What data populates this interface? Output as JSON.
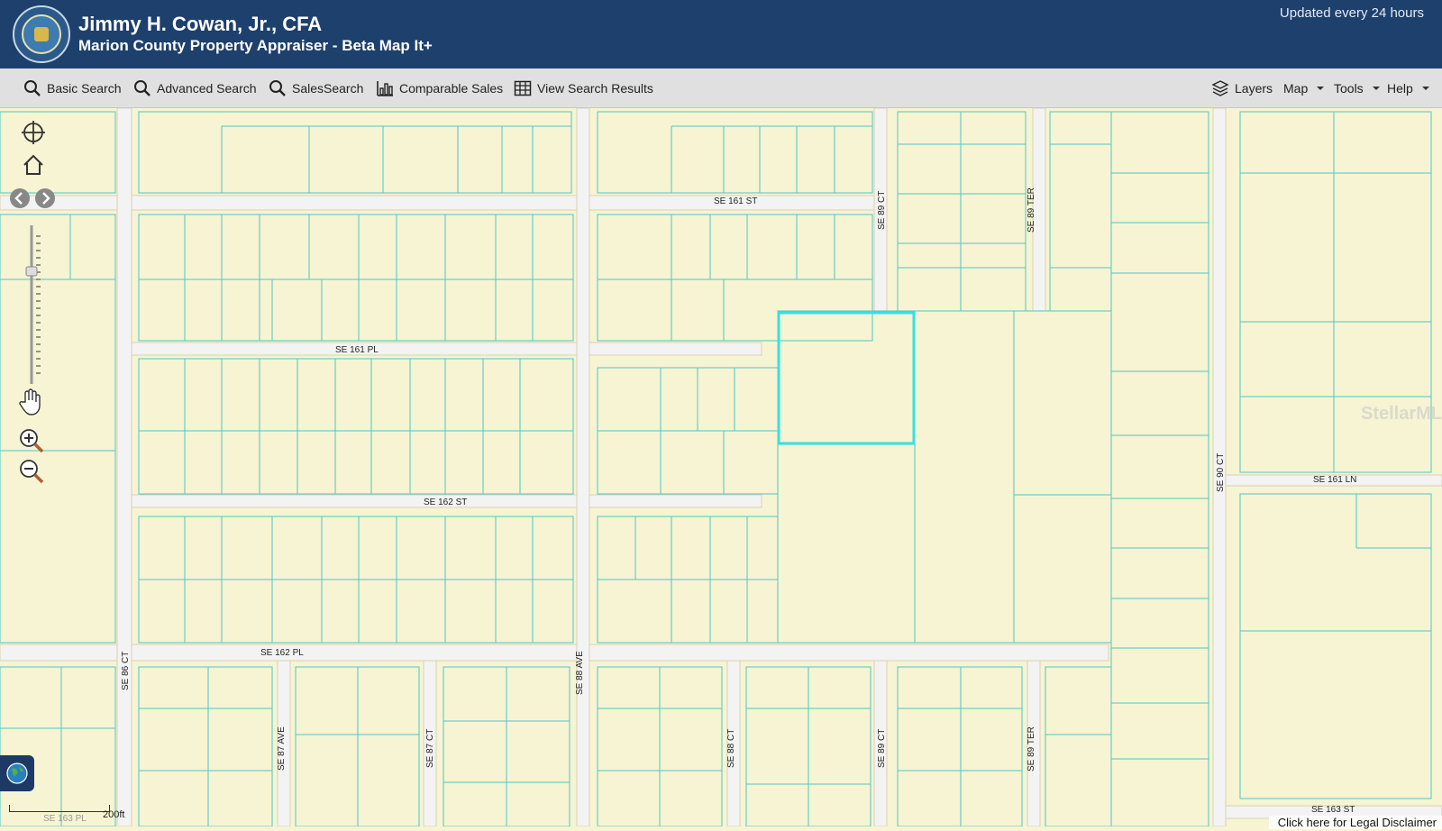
{
  "header": {
    "title": "Jimmy H. Cowan, Jr., CFA",
    "subtitle": "Marion County Property Appraiser - Beta Map It+",
    "updated": "Updated every 24 hours"
  },
  "toolbar": {
    "basic_search": "Basic Search",
    "advanced_search": "Advanced Search",
    "sales_search": "SalesSearch",
    "comparable_sales": "Comparable Sales",
    "view_results": "View Search Results",
    "layers": "Layers",
    "map": "Map",
    "tools": "Tools",
    "help": "Help"
  },
  "map": {
    "streets": {
      "se_161_st": "SE 161 ST",
      "se_161_pl": "SE 161 PL",
      "se_162_st": "SE 162 ST",
      "se_162_pl": "SE 162 PL",
      "se_161_ln": "SE 161 LN",
      "se_163_st": "SE 163 ST",
      "se_163_pl": "SE 163 PL",
      "se_89_ct": "SE 89 CT",
      "se_89_ter": "SE 89 TER",
      "se_90_ct": "SE 90 CT",
      "se_86_ct": "SE 86 CT",
      "se_87_ave": "SE 87 AVE",
      "se_87_ct": "SE 87 CT",
      "se_88_ave": "SE 88 AVE",
      "se_88_ct": "SE 88 CT"
    },
    "scale_label": "200ft",
    "watermark": "StellarMLS",
    "disclaimer": "Click here for Legal Disclaimer"
  },
  "colors": {
    "header_bg": "#1d406d",
    "parcel_fill": "#f6f4d2",
    "parcel_line": "#4fc6c6",
    "selection": "#35e0e6",
    "road": "#f3f3f3"
  }
}
